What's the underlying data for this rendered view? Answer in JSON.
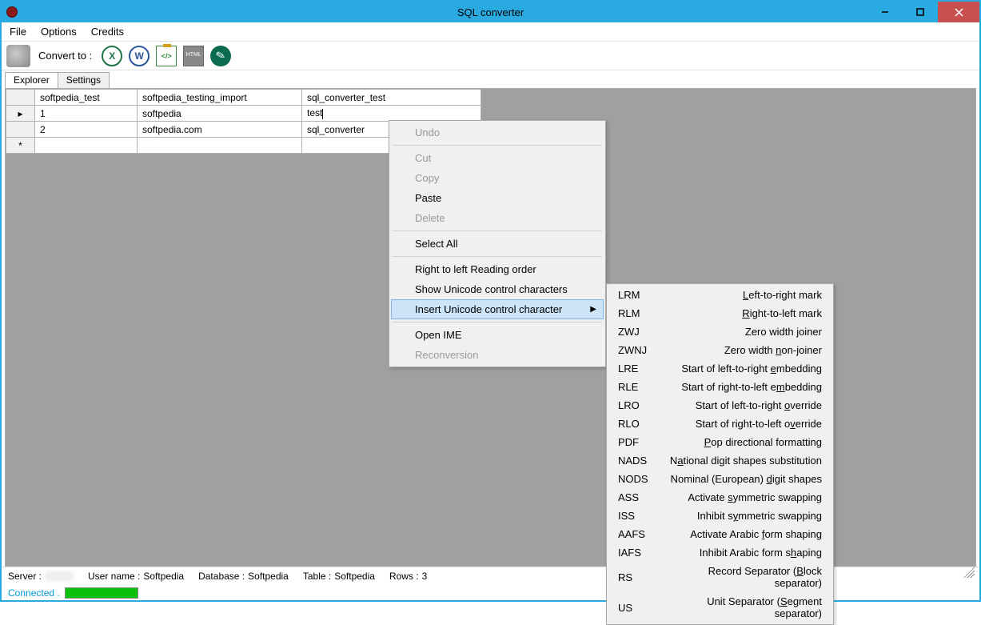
{
  "window": {
    "title": "SQL converter"
  },
  "menu": {
    "file": "File",
    "options": "Options",
    "credits": "Credits"
  },
  "toolbar": {
    "convert_label": "Convert to :"
  },
  "tabs": {
    "explorer": "Explorer",
    "settings": "Settings"
  },
  "table": {
    "headers": [
      "softpedia_test",
      "softpedia_testing_import",
      "sql_converter_test"
    ],
    "rows": [
      {
        "id": "1",
        "c2": "softpedia",
        "c3": "test"
      },
      {
        "id": "2",
        "c2": "softpedia.com",
        "c3": "sql_converter"
      }
    ]
  },
  "context": {
    "undo": "Undo",
    "cut": "Cut",
    "copy": "Copy",
    "paste": "Paste",
    "delete": "Delete",
    "select_all": "Select All",
    "rtl": "Right to left Reading order",
    "show_ucc": "Show Unicode control characters",
    "insert_ucc": "Insert Unicode control character",
    "open_ime": "Open IME",
    "reconversion": "Reconversion"
  },
  "submenu": [
    {
      "code": "LRM",
      "desc_pre": "",
      "u": "L",
      "desc_post": "eft-to-right mark"
    },
    {
      "code": "RLM",
      "desc_pre": "",
      "u": "R",
      "desc_post": "ight-to-left mark"
    },
    {
      "code": "ZWJ",
      "desc_pre": "Zero width ",
      "u": "j",
      "desc_post": "oiner"
    },
    {
      "code": "ZWNJ",
      "desc_pre": "Zero width ",
      "u": "n",
      "desc_post": "on-joiner"
    },
    {
      "code": "LRE",
      "desc_pre": "Start of left-to-right ",
      "u": "e",
      "desc_post": "mbedding"
    },
    {
      "code": "RLE",
      "desc_pre": "Start of right-to-left e",
      "u": "m",
      "desc_post": "bedding"
    },
    {
      "code": "LRO",
      "desc_pre": "Start of left-to-right ",
      "u": "o",
      "desc_post": "verride"
    },
    {
      "code": "RLO",
      "desc_pre": "Start of right-to-left o",
      "u": "v",
      "desc_post": "erride"
    },
    {
      "code": "PDF",
      "desc_pre": "",
      "u": "P",
      "desc_post": "op directional formatting"
    },
    {
      "code": "NADS",
      "desc_pre": "N",
      "u": "a",
      "desc_post": "tional digit shapes substitution"
    },
    {
      "code": "NODS",
      "desc_pre": "Nominal (European) ",
      "u": "d",
      "desc_post": "igit shapes"
    },
    {
      "code": "ASS",
      "desc_pre": "Activate ",
      "u": "s",
      "desc_post": "ymmetric swapping"
    },
    {
      "code": "ISS",
      "desc_pre": "Inhibit s",
      "u": "y",
      "desc_post": "mmetric swapping"
    },
    {
      "code": "AAFS",
      "desc_pre": "Activate Arabic ",
      "u": "f",
      "desc_post": "orm shaping"
    },
    {
      "code": "IAFS",
      "desc_pre": "Inhibit Arabic form s",
      "u": "h",
      "desc_post": "aping"
    },
    {
      "code": "RS",
      "desc_pre": "Record Separator (",
      "u": "B",
      "desc_post": "lock separator)"
    },
    {
      "code": "US",
      "desc_pre": "Unit Separator (",
      "u": "S",
      "desc_post": "egment separator)"
    }
  ],
  "status": {
    "server_label": "Server :",
    "user_label": "User name :",
    "user_value": "Softpedia",
    "db_label": "Database :",
    "db_value": "Softpedia",
    "table_label": "Table :",
    "table_value": "Softpedia",
    "rows_label": "Rows :",
    "rows_value": "3",
    "connected": "Connected ."
  }
}
